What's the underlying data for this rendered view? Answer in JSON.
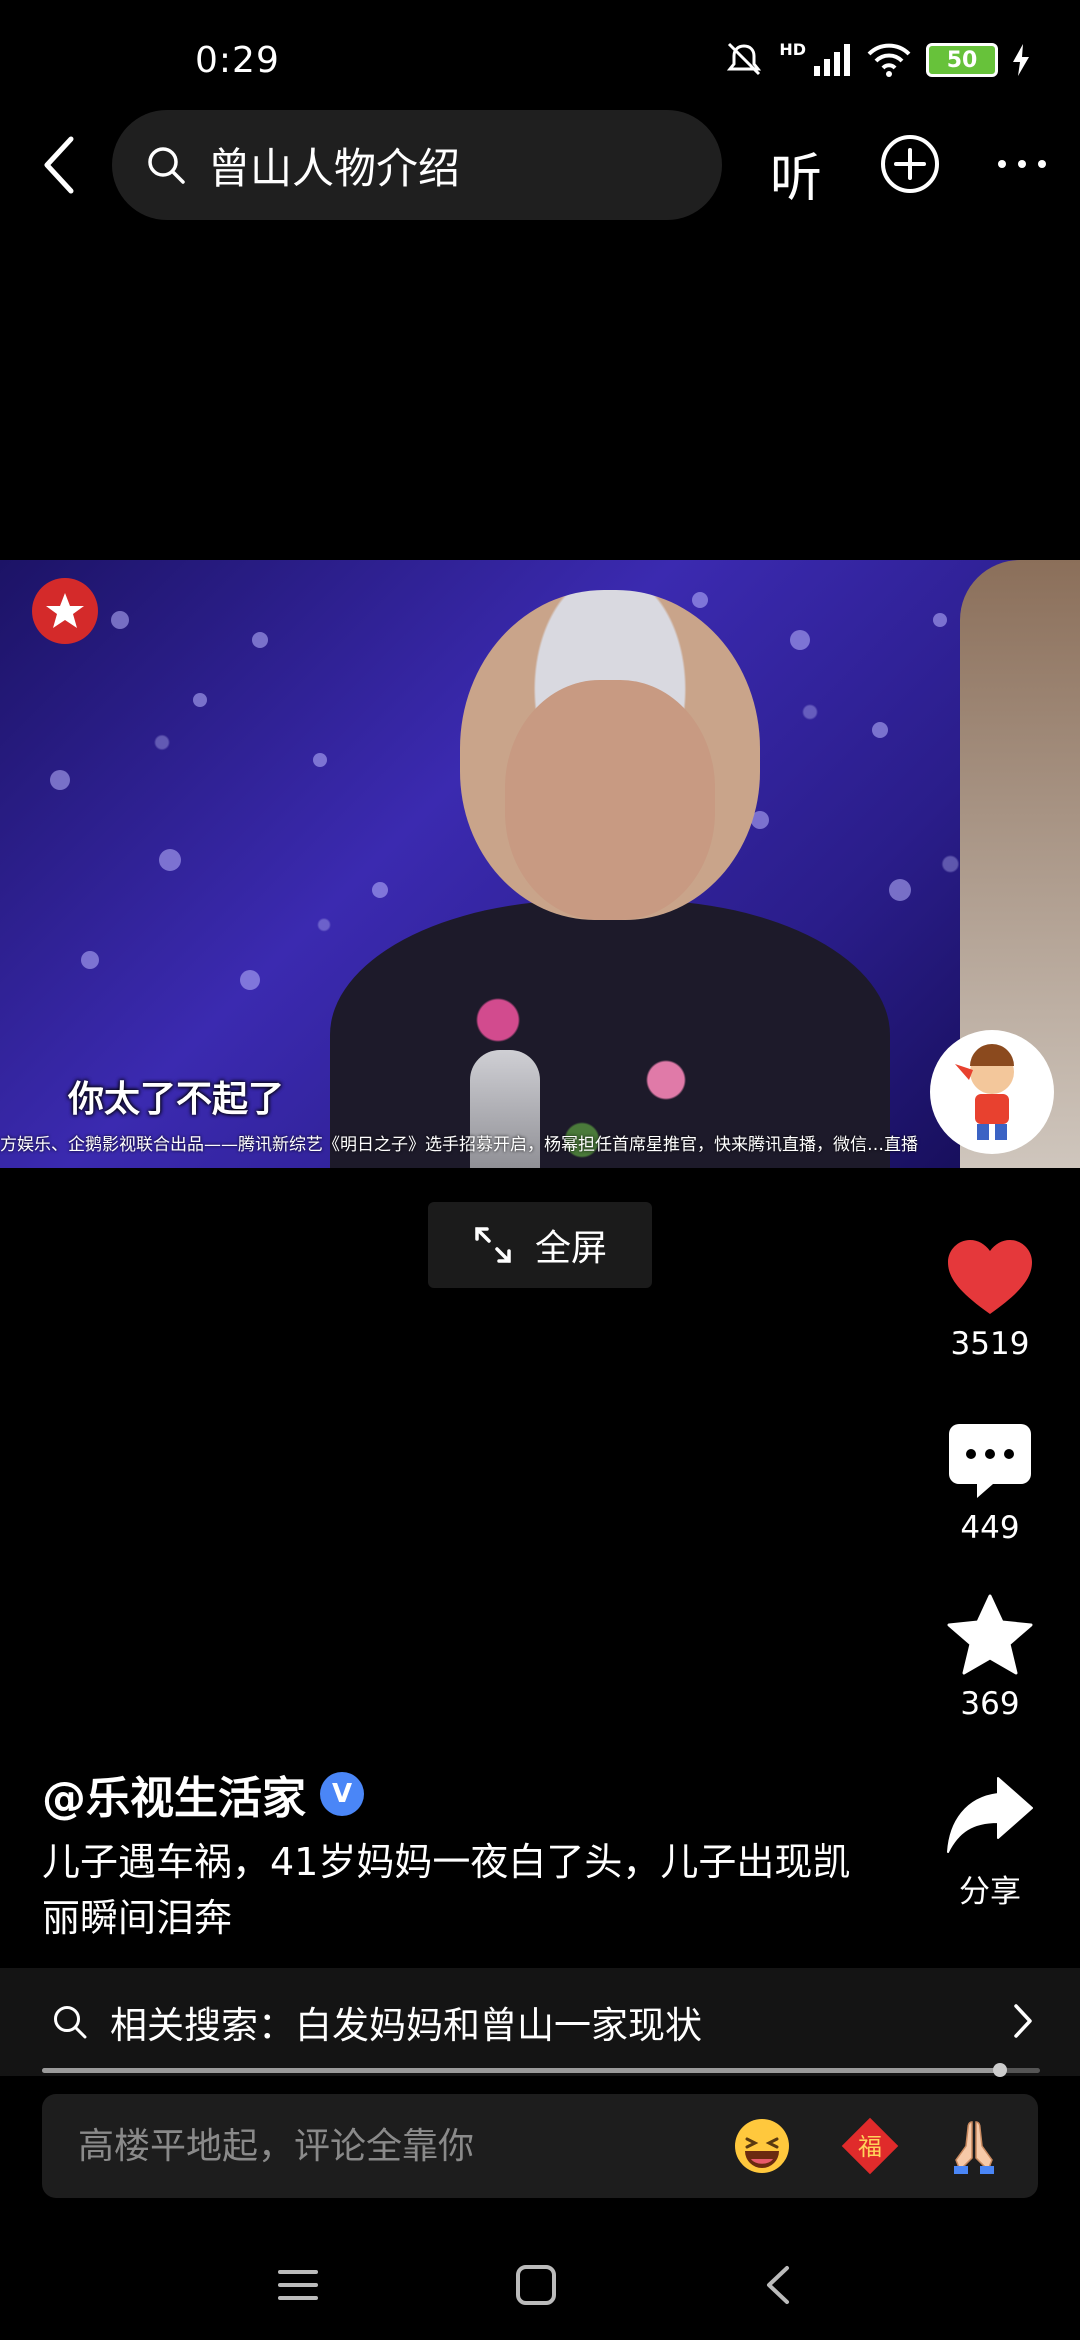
{
  "status_bar": {
    "time": "0:29",
    "network": "HD",
    "battery": "50"
  },
  "header": {
    "search_text": "曾山人物介绍",
    "listen_label": "听"
  },
  "video": {
    "subtitle": "你太了不起了",
    "ticker": "方娱乐、企鹅影视联合出品——腾讯新综艺《明日之子》选手招募开启，杨幂担任首席星推官，快来腾讯直播，微信…直播",
    "fullscreen_label": "全屏"
  },
  "actions": {
    "like_count": "3519",
    "comment_count": "449",
    "favorite_count": "369",
    "share_label": "分享"
  },
  "post": {
    "author": "@乐视生活家",
    "verified_badge": "V",
    "description": "儿子遇车祸，41岁妈妈一夜白了头，儿子出现凯丽瞬间泪奔"
  },
  "related": {
    "text": "相关搜索：白发妈妈和曾山一家现状"
  },
  "progress": {
    "fraction": 0.96
  },
  "comment": {
    "placeholder": "高楼平地起，评论全靠你"
  },
  "colors": {
    "like": "#e5383b",
    "background": "#000000",
    "bar": "#1d1d1d"
  }
}
